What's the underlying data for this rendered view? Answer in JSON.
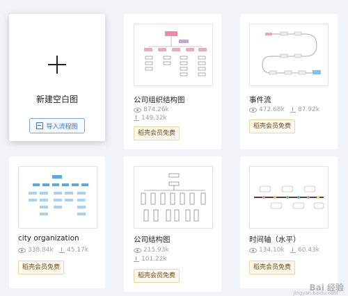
{
  "new_card": {
    "title": "新建空白图",
    "import_label": "导入流程图"
  },
  "templates": [
    {
      "title": "公司组织结构图",
      "views": "874.26k",
      "downloads": "149.32k",
      "badge": "稻壳会员免费"
    },
    {
      "title": "事件流",
      "views": "472.68k",
      "downloads": "87.92k",
      "badge": "稻壳会员免费"
    },
    {
      "title": "city organization",
      "views": "338.84k",
      "downloads": "45.17k",
      "badge": "稻壳会员免费"
    },
    {
      "title": "公司结构图",
      "views": "215.93k",
      "downloads": "101.22k",
      "badge": "稻壳会员免费"
    },
    {
      "title": "时间轴（水平）",
      "views": "134.10k",
      "downloads": "60.43k",
      "badge": "稻壳会员免费"
    }
  ],
  "watermark": {
    "main": "Bai 经验",
    "sub": "jingyan.baidu.com"
  }
}
